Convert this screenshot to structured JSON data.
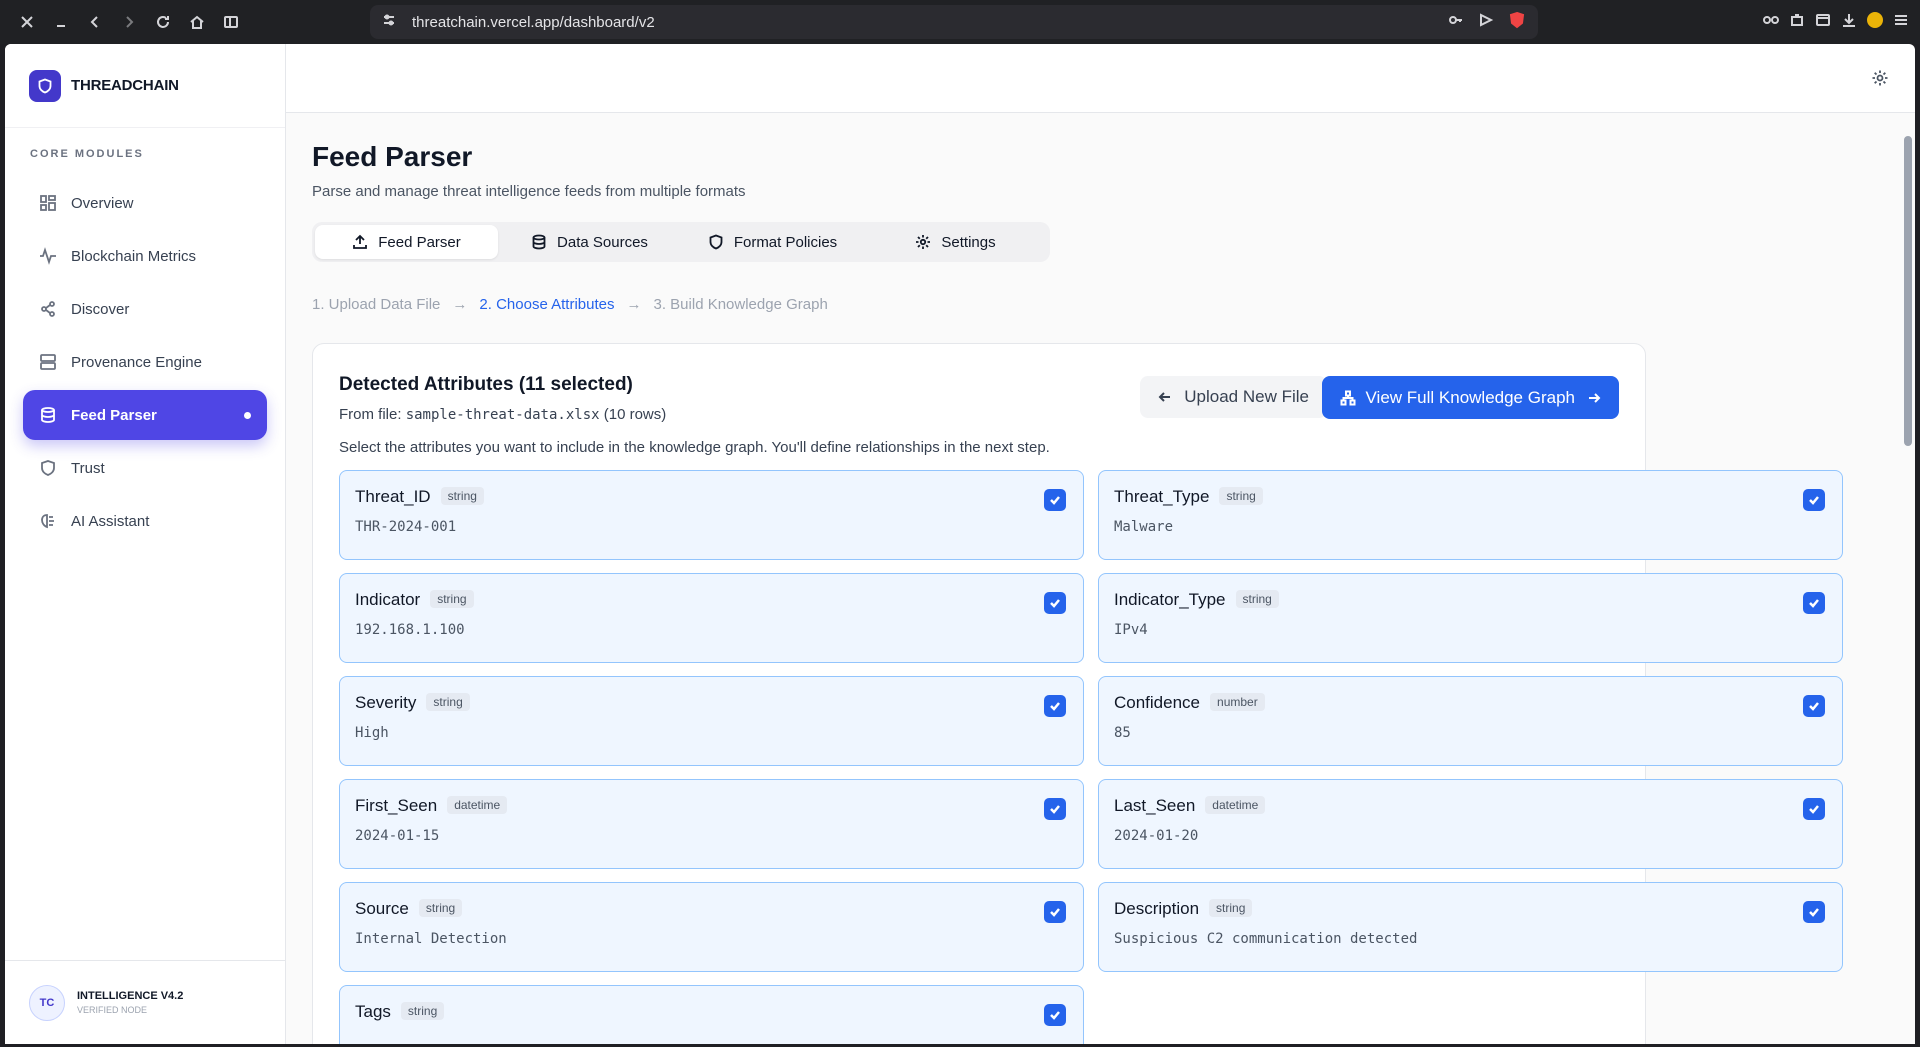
{
  "browser": {
    "url": "threatchain.vercel.app/dashboard/v2"
  },
  "sidebar": {
    "brand": "THREADCHAIN",
    "section_label": "CORE MODULES",
    "items": [
      {
        "label": "Overview"
      },
      {
        "label": "Blockchain Metrics"
      },
      {
        "label": "Discover"
      },
      {
        "label": "Provenance Engine"
      },
      {
        "label": "Feed Parser"
      },
      {
        "label": "Trust"
      },
      {
        "label": "AI Assistant"
      }
    ],
    "footer": {
      "avatar": "TC",
      "title": "INTELLIGENCE V4.2",
      "subtitle": "VERIFIED NODE"
    }
  },
  "page": {
    "title": "Feed Parser",
    "subtitle": "Parse and manage threat intelligence feeds from multiple formats"
  },
  "tabs": [
    {
      "label": "Feed Parser"
    },
    {
      "label": "Data Sources"
    },
    {
      "label": "Format Policies"
    },
    {
      "label": "Settings"
    }
  ],
  "steps": [
    {
      "label": "1. Upload Data File"
    },
    {
      "label": "2. Choose Attributes"
    },
    {
      "label": "3. Build Knowledge Graph"
    }
  ],
  "card": {
    "title": "Detected Attributes (11 selected)",
    "file_prefix": "From file: ",
    "file_name": "sample-threat-data.xlsx",
    "file_suffix": " (10 rows)",
    "upload_button": "Upload New File",
    "graph_button": "View Full Knowledge Graph",
    "instructions": "Select the attributes you want to include in the knowledge graph. You'll define relationships in the next step."
  },
  "attributes": [
    {
      "name": "Threat_ID",
      "type": "string",
      "value": "THR-2024-001",
      "checked": true
    },
    {
      "name": "Threat_Type",
      "type": "string",
      "value": "Malware",
      "checked": true
    },
    {
      "name": "Indicator",
      "type": "string",
      "value": "192.168.1.100",
      "checked": true
    },
    {
      "name": "Indicator_Type",
      "type": "string",
      "value": "IPv4",
      "checked": true
    },
    {
      "name": "Severity",
      "type": "string",
      "value": "High",
      "checked": true
    },
    {
      "name": "Confidence",
      "type": "number",
      "value": "85",
      "checked": true
    },
    {
      "name": "First_Seen",
      "type": "datetime",
      "value": "2024-01-15",
      "checked": true
    },
    {
      "name": "Last_Seen",
      "type": "datetime",
      "value": "2024-01-20",
      "checked": true
    },
    {
      "name": "Source",
      "type": "string",
      "value": "Internal Detection",
      "checked": true
    },
    {
      "name": "Description",
      "type": "string",
      "value": "Suspicious C2 communication detected",
      "checked": true
    },
    {
      "name": "Tags",
      "type": "string",
      "value": "",
      "checked": true
    }
  ]
}
